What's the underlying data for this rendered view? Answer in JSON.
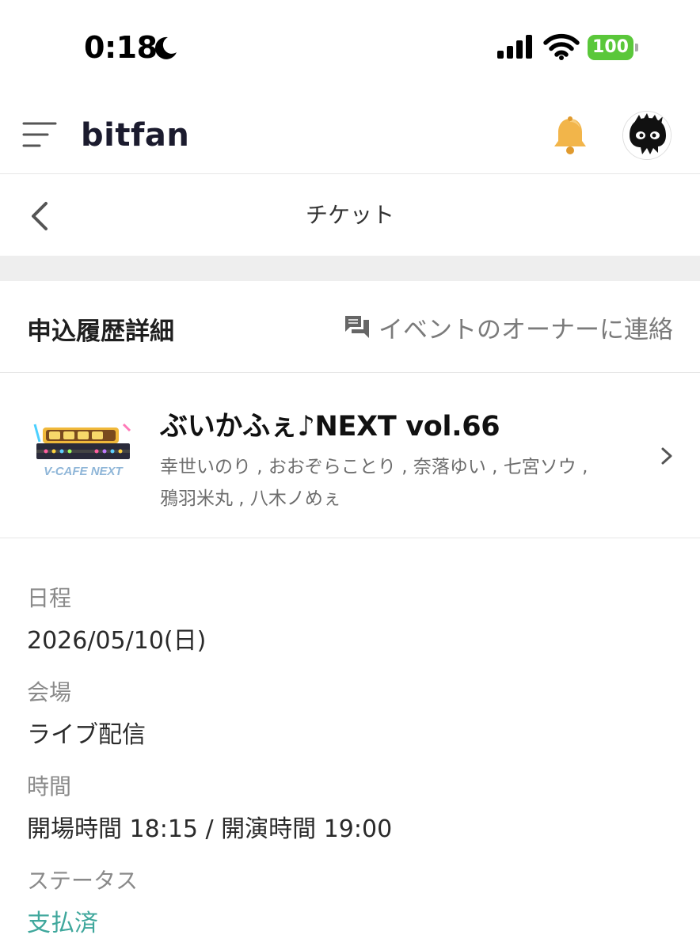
{
  "status_bar": {
    "time": "0:18",
    "battery": "100"
  },
  "header": {
    "logo": "bitfan"
  },
  "nav": {
    "title": "チケット"
  },
  "section": {
    "title": "申込履歴詳細",
    "contact_label": "イベントのオーナーに連絡"
  },
  "event": {
    "title": "ぶいかふぇ♪NEXT vol.66",
    "performers": "幸世いのり , おおぞらことり , 奈落ゆい , 七宮ソウ , 鴉羽米丸 , 八木ノめぇ",
    "thumbnail_caption": "V-CAFE NEXT"
  },
  "details": [
    {
      "label": "日程",
      "value": "2026/05/10(日)"
    },
    {
      "label": "会場",
      "value": "ライブ配信"
    },
    {
      "label": "時間",
      "value": "開場時間 18:15 / 開演時間 19:00"
    },
    {
      "label": "ステータス",
      "value": "支払済"
    }
  ],
  "colors": {
    "status_accent": "#3fa79c",
    "battery": "#5ac73a",
    "bell": "#f2b54a"
  }
}
